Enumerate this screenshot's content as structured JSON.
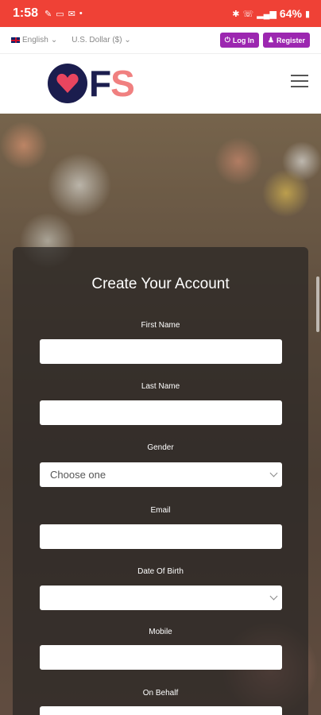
{
  "status_bar": {
    "time": "1:58",
    "battery": "64%"
  },
  "util_bar": {
    "language": "English",
    "currency": "U.S. Dollar ($)",
    "login_label": "Log In",
    "register_label": "Register"
  },
  "header": {
    "logo_text_1": "F",
    "logo_text_2": "S"
  },
  "form": {
    "title": "Create Your Account",
    "first_name_label": "First Name",
    "last_name_label": "Last Name",
    "gender_label": "Gender",
    "gender_value": "Choose one",
    "email_label": "Email",
    "dob_label": "Date Of Birth",
    "mobile_label": "Mobile",
    "on_behalf_label": "On Behalf"
  },
  "colors": {
    "status_bar": "#ef4136",
    "button_purple": "#9c27b0",
    "logo_navy": "#1b1d4e",
    "logo_pink": "#f08080"
  }
}
